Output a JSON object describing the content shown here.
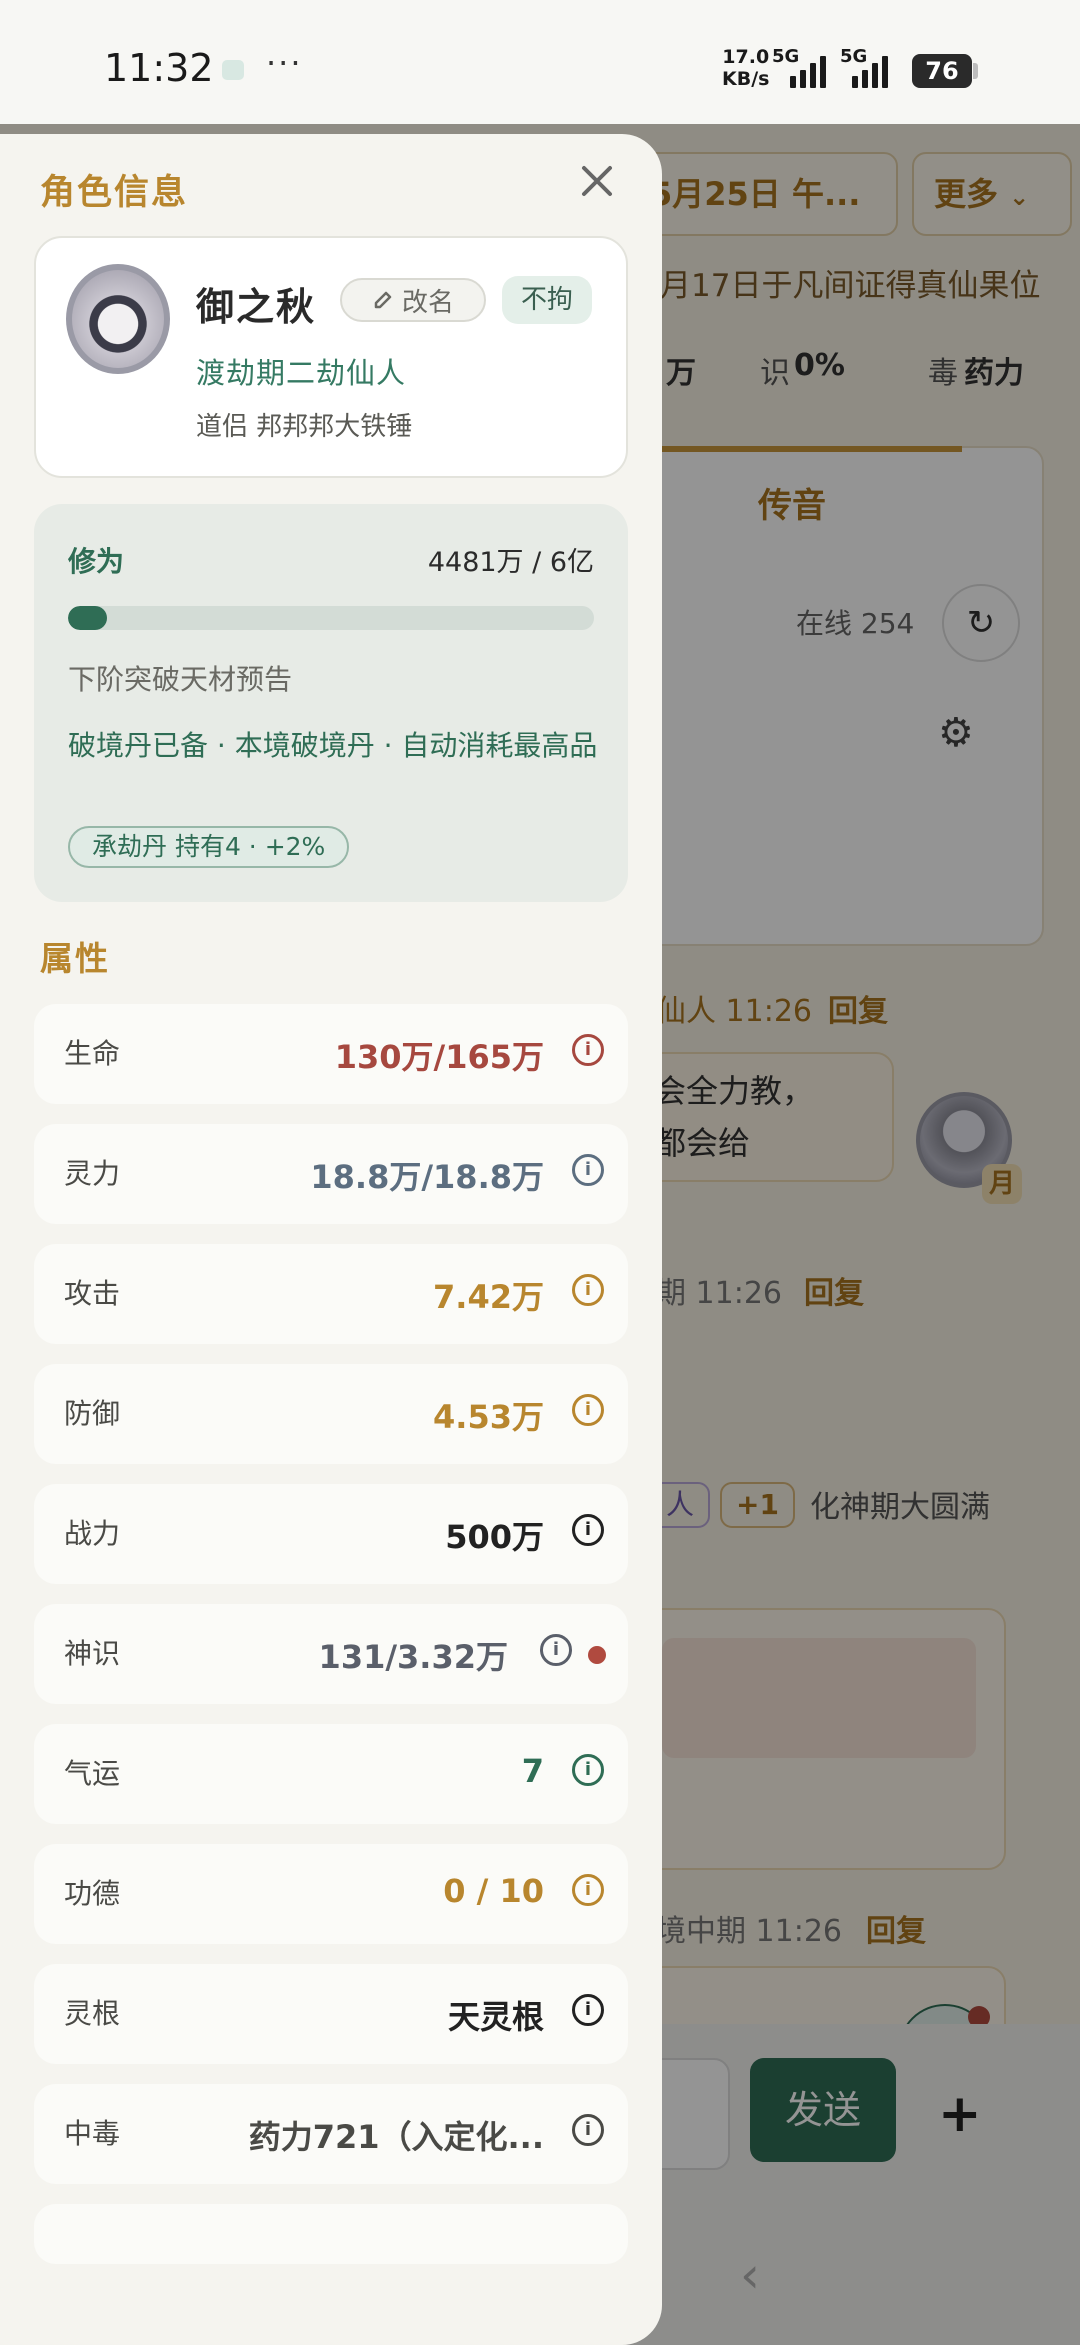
{
  "status_bar": {
    "time": "11:32",
    "dots": "···",
    "speed_value": "17.0",
    "speed_unit": "KB/s",
    "network_1": "5G",
    "network_2": "5G",
    "battery": "76"
  },
  "background": {
    "date_tab": "5月25日 午...",
    "more_button": "更多",
    "ticker": "月17日于凡间证得真仙果位",
    "stats": [
      "万",
      "识",
      "0%",
      "毒",
      "药力"
    ],
    "panel_title": "传音",
    "online": "在线 254",
    "msg1_meta": "仙人  11:26",
    "msg1_reply": "回复",
    "msg1_text_1": "会全力教，",
    "msg1_text_2": "都会给",
    "msg2_meta": "期  11:26",
    "msg2_reply": "回复",
    "tag1": "人",
    "tag2": "+1",
    "tag_text": "化神期大圆满",
    "msg3_meta": "境中期  11:26",
    "msg3_reply": "回复",
    "send_label": "发送",
    "plus_label": "+",
    "moon_badge": "月"
  },
  "drawer": {
    "title": "角色信息",
    "profile": {
      "name": "御之秋",
      "rename_label": "改名",
      "badge": "不拘",
      "realm": "渡劫期二劫仙人",
      "partner": "道侣 邦邦邦大铁锤"
    },
    "cultivation": {
      "label": "修为",
      "value": "4481万 / 6亿",
      "progress_percent": 7.5,
      "note": "下阶突破天材预告",
      "pill_line": "破境丹已备 · 本境破境丹 · 自动消耗最高品",
      "chip": "承劫丹 持有4 · +2%"
    },
    "attributes_title": "属性",
    "attributes": [
      {
        "label": "生命",
        "value": "130万/165万",
        "color": "#a6483f"
      },
      {
        "label": "灵力",
        "value": "18.8万/18.8万",
        "color": "#5c6e80"
      },
      {
        "label": "攻击",
        "value": "7.42万",
        "color": "#b8862e"
      },
      {
        "label": "防御",
        "value": "4.53万",
        "color": "#b8862e"
      },
      {
        "label": "战力",
        "value": "500万",
        "color": "#222222"
      },
      {
        "label": "神识",
        "value": "131/3.32万",
        "color": "#5a5f6a"
      },
      {
        "label": "气运",
        "value": "7",
        "color": "#2f6d55"
      },
      {
        "label": "功德",
        "value": "0 / 10",
        "color": "#b8862e"
      },
      {
        "label": "灵根",
        "value": "天灵根",
        "color": "#222222"
      },
      {
        "label": "中毒",
        "value": "药力721（入定化...",
        "color": "#4a4a46"
      }
    ]
  }
}
